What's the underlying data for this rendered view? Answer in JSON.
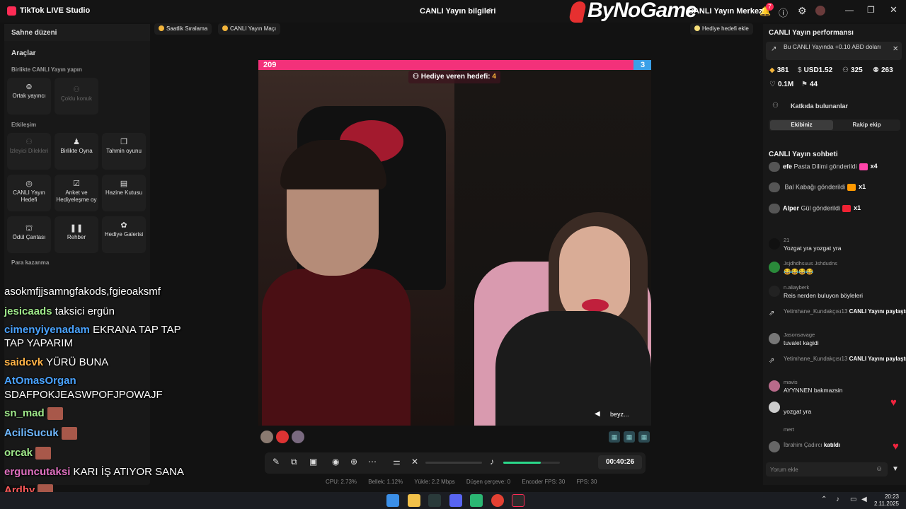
{
  "titlebar": {
    "app_name": "TikTok LIVE Studio",
    "live_info": "CANLI Yayın bilgileri",
    "watermark": "ByNoGame",
    "live_center": "CANLI Yayın Merkezi",
    "notif_count": "7"
  },
  "left_panel": {
    "scene": "Sahne düzeni",
    "tools_title": "Araçlar",
    "section_collab": "Birlikte CANLI Yayın yapın",
    "section_interaction": "Etkileşim",
    "section_earn": "Para kazanma",
    "tools": [
      {
        "label": "Ortak yayıncı",
        "icon": "co-host-icon"
      },
      {
        "label": "Çoklu konuk",
        "icon": "multi-guest-icon"
      },
      {
        "label": "İzleyici Dilekleri",
        "icon": "viewer-wishes-icon"
      },
      {
        "label": "Birlikte Oyna",
        "icon": "play-together-icon"
      },
      {
        "label": "Tahmin oyunu",
        "icon": "prediction-icon"
      },
      {
        "label": "CANLI Yayın Hedefi",
        "icon": "live-goal-icon"
      },
      {
        "label": "Anket ve Hediyeleşme oy",
        "icon": "poll-icon"
      },
      {
        "label": "Hazine Kutusu",
        "icon": "treasure-box-icon"
      },
      {
        "label": "Ödül Çantası",
        "icon": "reward-bag-icon"
      },
      {
        "label": "Rehber",
        "icon": "guide-icon"
      },
      {
        "label": "Hediye Galerisi",
        "icon": "gift-gallery-icon"
      }
    ]
  },
  "overlay_chat": [
    {
      "user": "",
      "text": "asokmfjjsamngfakods,fgieoaksmf",
      "color": "#ffffff"
    },
    {
      "user": "jesicaads",
      "text": "taksici ergün",
      "color": "#9fe88a"
    },
    {
      "user": "cimenyiyenadam",
      "text": "EKRANA TAP TAP",
      "color": "#4aa3ff"
    },
    {
      "user": "",
      "text": "TAP YAPARIM",
      "color": "#ffffff"
    },
    {
      "user": "saidcvk",
      "text": "YÜRÜ BUNA",
      "color": "#ffb347"
    },
    {
      "user": "AtOmasOrgan",
      "text": "",
      "color": "#4aa3ff"
    },
    {
      "user": "",
      "text": "SDAFPOKJEASWPOFJPOWAJF",
      "color": "#ffffff"
    },
    {
      "user": "sn_mad",
      "text": "",
      "color": "#9fe88a"
    },
    {
      "user": "AciliSucuk",
      "text": "",
      "color": "#6fb8ff"
    },
    {
      "user": "orcak",
      "text": "",
      "color": "#9fe88a"
    },
    {
      "user": "erguncutaksi",
      "text": "KARI İŞ ATIYOR SANA",
      "color": "#e070c0"
    },
    {
      "user": "Ardhy",
      "text": "",
      "color": "#ff5a5a"
    }
  ],
  "top_pills": {
    "hourly": "Saatlik Sıralama",
    "match": "CANLI Yayın Maçı",
    "gift_goal_add": "Hediye hedefi ekle"
  },
  "stage": {
    "score_left": "209",
    "score_right": "3",
    "gift_goal_label": "Hediye veren hedefi:",
    "gift_goal_value": "4",
    "cam_label": "beyz..."
  },
  "controls": {
    "timer": "00:40:26",
    "mic_level": 0.66,
    "stats": [
      "CPU: 2.73%",
      "Bellek: 1.12%",
      "Yükle: 2.2 Mbps",
      "Düşen çerçeve: 0",
      "Encoder FPS: 30",
      "FPS: 30"
    ]
  },
  "right_panel": {
    "perf_title": "CANLI Yayın performansı",
    "perf_note": "Bu CANLI Yayında +0.10 ABD doları",
    "stats_row1": [
      "381",
      "USD1.52",
      "325",
      "263"
    ],
    "stats_row2": [
      "0.1M",
      "44"
    ],
    "contributors": "Katkıda bulunanlar",
    "tab_ours": "Ekibiniz",
    "tab_rival": "Rakip ekip",
    "chat_title": "CANLI Yayın sohbeti",
    "gifts": [
      {
        "user": "efe",
        "text": "Pasta Dilimi gönderildi",
        "count": "x4"
      },
      {
        "user": "",
        "text": "Bal Kabağı gönderildi",
        "count": "x1"
      },
      {
        "user": "Alper",
        "text": "Gül gönderildi",
        "count": "x1"
      }
    ],
    "messages": [
      {
        "user": "21",
        "text": "Yozgat yra yozgat yra"
      },
      {
        "user": "Jsjdhdhsuus Jshdudns",
        "text": "😂😂😂😂"
      },
      {
        "user": "n.aliayberk",
        "text": "Reis nerden buluyon böyleleri"
      },
      {
        "user": "Yetimhane_Kundakçısı13",
        "action": "CANLI Yayını paylaştı"
      },
      {
        "user": "Jasonsavage",
        "text": "tuvalet kagidi"
      },
      {
        "user": "Yetimhane_Kundakçısı13",
        "action": "CANLI Yayını paylaştı"
      },
      {
        "user": "mavis",
        "text": "AYYNNEN bakmazsin"
      },
      {
        "user": "",
        "text": "yozgat yra"
      },
      {
        "user": "mert",
        "text": ""
      },
      {
        "user": "İbrahim Çadırcı",
        "action": "katıldı"
      }
    ],
    "comment_placeholder": "Yorum ekle"
  },
  "taskbar": {
    "time": "20:23",
    "date": "2.11.2025"
  }
}
